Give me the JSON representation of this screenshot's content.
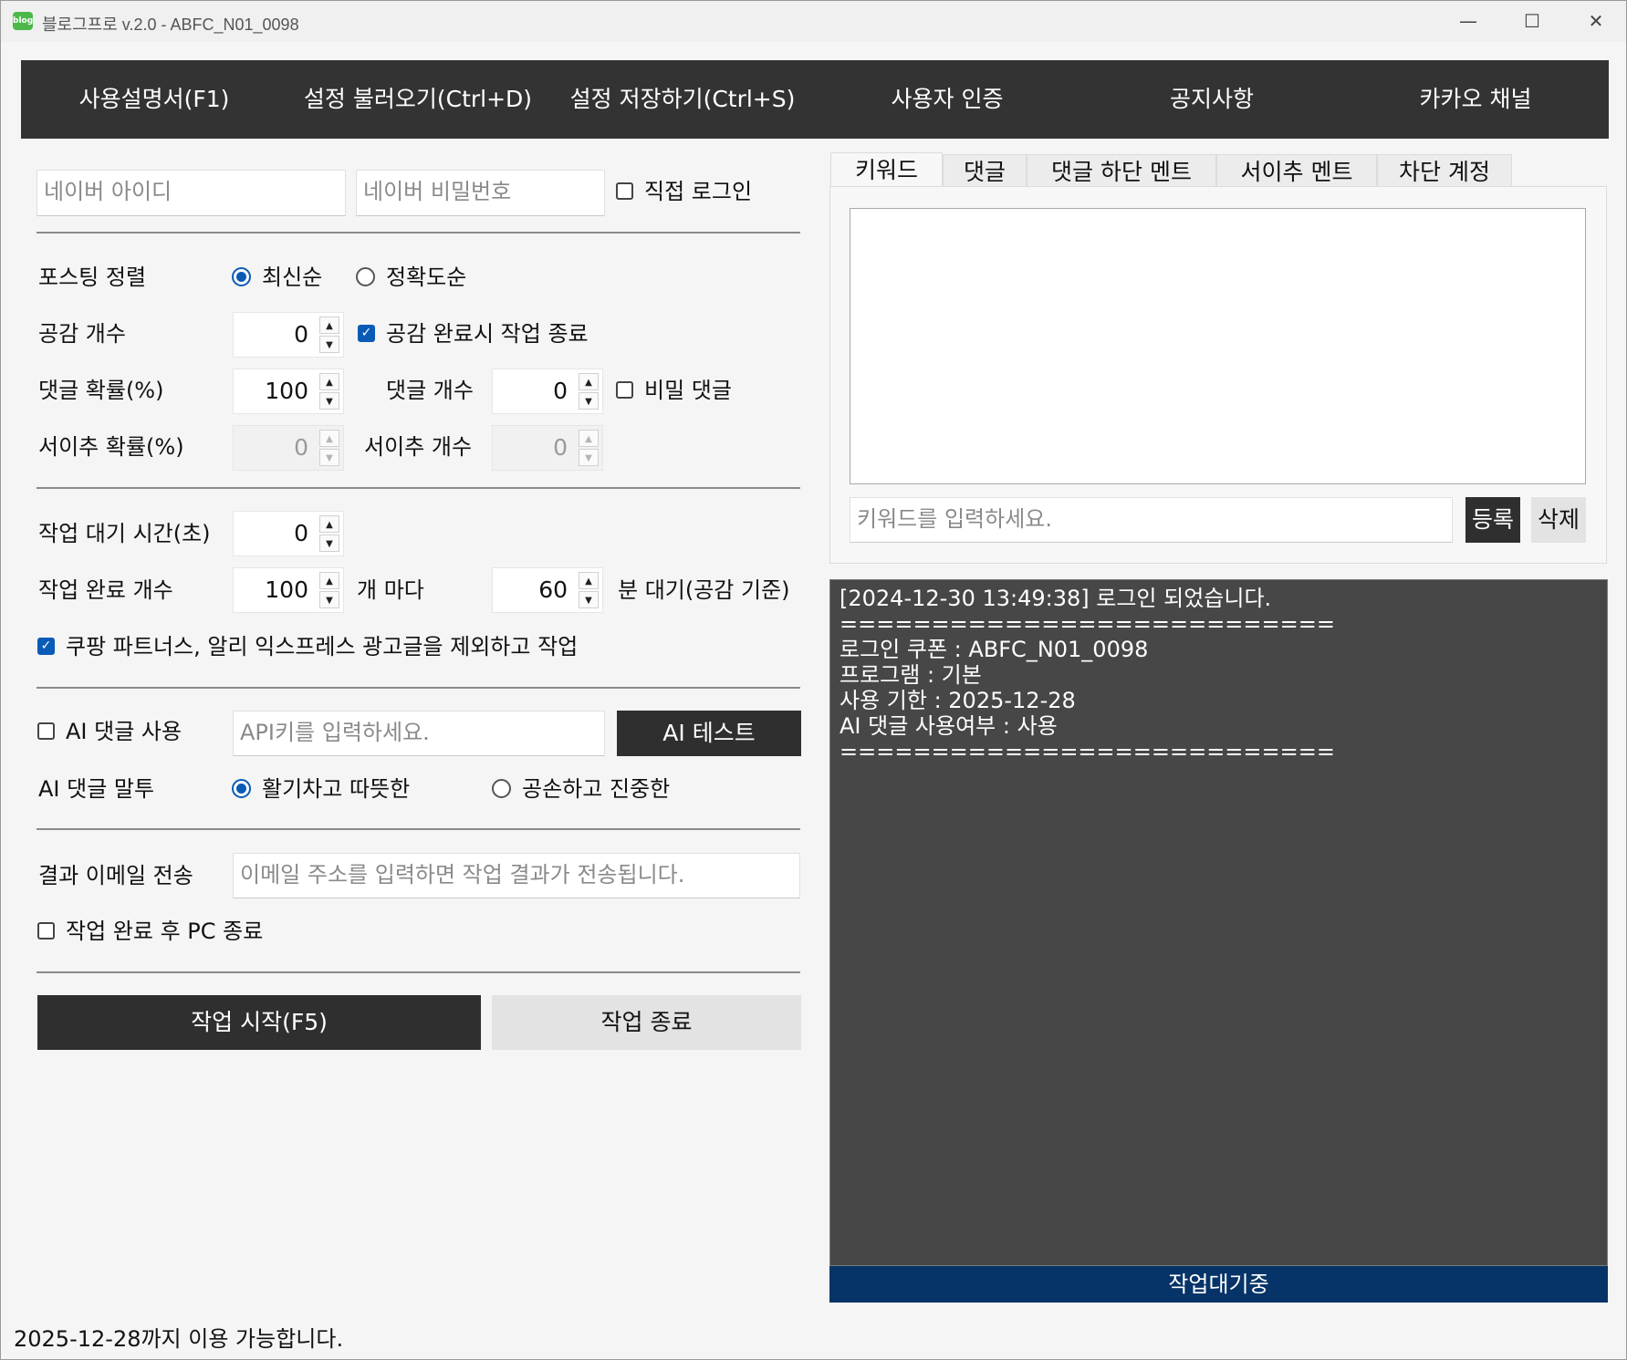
{
  "window": {
    "title": "블로그프로 v.2.0 - ABFC_N01_0098",
    "icon_text": "blog"
  },
  "menu": [
    "사용설명서(F1)",
    "설정 불러오기(Ctrl+D)",
    "설정 저장하기(Ctrl+S)",
    "사용자 인증",
    "공지사항",
    "카카오 채널"
  ],
  "login": {
    "id_placeholder": "네이버 아이디",
    "pw_placeholder": "네이버 비밀번호",
    "direct_login_label": "직접 로그인",
    "direct_login_checked": false
  },
  "posting_sort": {
    "label": "포스팅 정렬",
    "options": [
      "최신순",
      "정확도순"
    ],
    "selected": "최신순"
  },
  "like_count": {
    "label": "공감 개수",
    "value": "0",
    "stop_label": "공감 완료시 작업 종료",
    "stop_checked": true
  },
  "comment_prob": {
    "label": "댓글 확률(%)",
    "value": "100",
    "count_label": "댓글 개수",
    "count_value": "0",
    "secret_label": "비밀 댓글",
    "secret_checked": false
  },
  "neighbor_prob": {
    "label": "서이추 확률(%)",
    "value": "0",
    "count_label": "서이추 개수",
    "count_value": "0"
  },
  "wait_time": {
    "label": "작업 대기 시간(초)",
    "value": "0"
  },
  "complete_count": {
    "label": "작업 완료 개수",
    "value": "100",
    "every_label": "개 마다",
    "minutes_value": "60",
    "minutes_label": "분 대기(공감 기준)"
  },
  "exclude_ads": {
    "label": "쿠팡 파트너스, 알리 익스프레스 광고글을 제외하고 작업",
    "checked": true
  },
  "ai": {
    "use_label": "AI 댓글 사용",
    "use_checked": false,
    "api_placeholder": "API키를 입력하세요.",
    "test_button": "AI 테스트",
    "tone_label": "AI 댓글 말투",
    "tone_options": [
      "활기차고 따뜻한",
      "공손하고 진중한"
    ],
    "tone_selected": "활기차고 따뜻한"
  },
  "email": {
    "label": "결과 이메일 전송",
    "placeholder": "이메일 주소를 입력하면 작업 결과가 전송됩니다."
  },
  "shutdown": {
    "label": "작업 완료 후 PC 종료",
    "checked": false
  },
  "actions": {
    "start": "작업 시작(F5)",
    "stop": "작업 종료"
  },
  "tabs": [
    "키워드",
    "댓글",
    "댓글 하단 멘트",
    "서이추 멘트",
    "차단 계정"
  ],
  "active_tab": "키워드",
  "keyword": {
    "placeholder": "키워드를 입력하세요.",
    "register": "등록",
    "delete": "삭제"
  },
  "log": [
    "[2024-12-30 13:49:38] 로그인 되었습니다.",
    "===========================",
    "로그인 쿠폰 : ABFC_N01_0098",
    "프로그램 : 기본",
    "사용 기한 : 2025-12-28",
    "AI 댓글 사용여부 : 사용",
    "==========================="
  ],
  "status": "작업대기중",
  "footer": "2025-12-28까지 이용 가능합니다."
}
